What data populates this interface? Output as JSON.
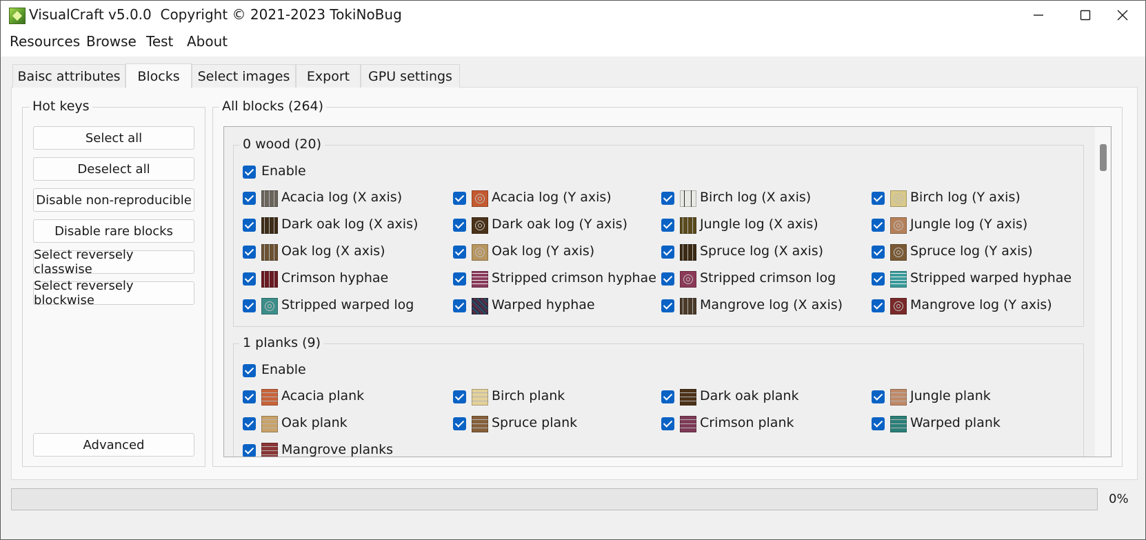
{
  "window": {
    "title": "VisualCraft v5.0.0  Copyright © 2021-2023 TokiNoBug",
    "controls": [
      "minimize-icon",
      "maximize-icon",
      "close-icon"
    ]
  },
  "menu": [
    "Resources",
    "Browse",
    "Test",
    "About"
  ],
  "tabs": [
    {
      "label": "Baisc attributes",
      "active": false
    },
    {
      "label": "Blocks",
      "active": true
    },
    {
      "label": "Select images",
      "active": false
    },
    {
      "label": "Export",
      "active": false
    },
    {
      "label": "GPU settings",
      "active": false
    }
  ],
  "hotkeys": {
    "title": "Hot keys",
    "buttons": [
      "Select all",
      "Deselect all",
      "Disable non-reproducible",
      "Disable rare blocks",
      "Select reversely classwise",
      "Select reversely blockwise"
    ],
    "advanced": "Advanced"
  },
  "blocks_panel": {
    "title": "All blocks (264)",
    "categories": [
      {
        "title": "0 wood (20)",
        "enable_label": "Enable",
        "enabled": true,
        "blocks": [
          {
            "name": "Acacia log (X axis)",
            "checked": true,
            "color": "#6b655c",
            "pattern": "bark"
          },
          {
            "name": "Acacia log (Y axis)",
            "checked": true,
            "color": "#c55a30",
            "pattern": "rings"
          },
          {
            "name": "Birch log (X axis)",
            "checked": true,
            "color": "#e8e8e4",
            "pattern": "birch"
          },
          {
            "name": "Birch log (Y axis)",
            "checked": true,
            "color": "#d9c98a",
            "pattern": "rings"
          },
          {
            "name": "Dark oak log (X axis)",
            "checked": true,
            "color": "#3e2d18",
            "pattern": "bark"
          },
          {
            "name": "Dark oak log (Y axis)",
            "checked": true,
            "color": "#4a3219",
            "pattern": "rings"
          },
          {
            "name": "Jungle log (X axis)",
            "checked": true,
            "color": "#5a4a1c",
            "pattern": "bark"
          },
          {
            "name": "Jungle log (Y axis)",
            "checked": true,
            "color": "#b5805a",
            "pattern": "rings"
          },
          {
            "name": "Oak log (X axis)",
            "checked": true,
            "color": "#6b5232",
            "pattern": "bark"
          },
          {
            "name": "Oak log (Y axis)",
            "checked": true,
            "color": "#b89660",
            "pattern": "rings"
          },
          {
            "name": "Spruce log (X axis)",
            "checked": true,
            "color": "#3b2a14",
            "pattern": "bark"
          },
          {
            "name": "Spruce log (Y axis)",
            "checked": true,
            "color": "#7a5a34",
            "pattern": "rings"
          },
          {
            "name": "Crimson hyphae",
            "checked": true,
            "color": "#6a1a22",
            "pattern": "bark"
          },
          {
            "name": "Stripped crimson hyphae",
            "checked": true,
            "color": "#8a3a5c",
            "pattern": "stripe"
          },
          {
            "name": "Stripped crimson log",
            "checked": true,
            "color": "#8c3a58",
            "pattern": "rings"
          },
          {
            "name": "Stripped warped hyphae",
            "checked": true,
            "color": "#3a9a9a",
            "pattern": "stripe"
          },
          {
            "name": "Stripped warped log",
            "checked": true,
            "color": "#3c8e8a",
            "pattern": "rings"
          },
          {
            "name": "Warped hyphae",
            "checked": true,
            "color": "#35304a",
            "pattern": "warped"
          },
          {
            "name": "Mangrove log (X axis)",
            "checked": true,
            "color": "#4a3a28",
            "pattern": "bark"
          },
          {
            "name": "Mangrove log (Y axis)",
            "checked": true,
            "color": "#7a2a2a",
            "pattern": "rings"
          }
        ]
      },
      {
        "title": "1 planks (9)",
        "enable_label": "Enable",
        "enabled": true,
        "blocks": [
          {
            "name": "Acacia plank",
            "checked": true,
            "color": "#c8643a",
            "pattern": "plank"
          },
          {
            "name": "Birch plank",
            "checked": true,
            "color": "#e3d19a",
            "pattern": "plank"
          },
          {
            "name": "Dark oak plank",
            "checked": true,
            "color": "#4c3218",
            "pattern": "plank"
          },
          {
            "name": "Jungle plank",
            "checked": true,
            "color": "#c08a68",
            "pattern": "plank"
          },
          {
            "name": "Oak plank",
            "checked": true,
            "color": "#c9a36a",
            "pattern": "plank"
          },
          {
            "name": "Spruce plank",
            "checked": true,
            "color": "#86603a",
            "pattern": "plank"
          },
          {
            "name": "Crimson plank",
            "checked": true,
            "color": "#7e3a56",
            "pattern": "plank"
          },
          {
            "name": "Warped plank",
            "checked": true,
            "color": "#2b8078",
            "pattern": "plank"
          },
          {
            "name": "Mangrove planks",
            "checked": true,
            "color": "#8a3434",
            "pattern": "plank"
          }
        ]
      }
    ]
  },
  "progress": {
    "value": 0,
    "text": "0%",
    "color": "#06b025"
  }
}
